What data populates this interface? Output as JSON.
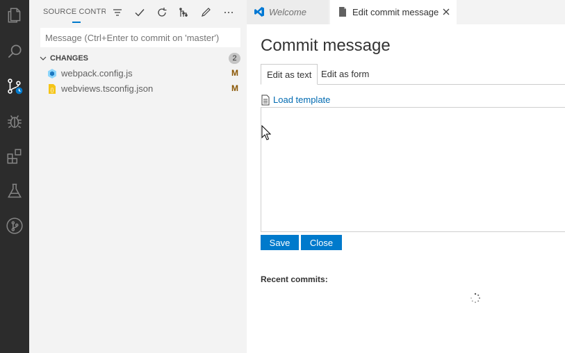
{
  "activity_bar": {
    "items": [
      {
        "icon": "explorer-icon"
      },
      {
        "icon": "search-icon"
      },
      {
        "icon": "source-control-icon",
        "active": true
      },
      {
        "icon": "debug-icon"
      },
      {
        "icon": "extensions-icon"
      },
      {
        "icon": "testing-icon"
      },
      {
        "icon": "git-graph-icon"
      }
    ]
  },
  "sidebar": {
    "title": "SOURCE CONTR...",
    "toolbar_icons": [
      "filter-icon",
      "commit-check-icon",
      "refresh-icon",
      "branch-graph-icon",
      "edit-pencil-icon",
      "more-actions-icon"
    ],
    "commit_placeholder": "Message (Ctrl+Enter to commit on 'master')",
    "changes": {
      "label": "CHANGES",
      "count": "2",
      "files": [
        {
          "name": "webpack.config.js",
          "status": "M",
          "icon": "webpack-file-icon"
        },
        {
          "name": "webviews.tsconfig.json",
          "status": "M",
          "icon": "json-file-icon"
        }
      ]
    }
  },
  "tabs": [
    {
      "label": "Welcome",
      "icon": "vscode-logo-icon",
      "active": false
    },
    {
      "label": "Edit commit message",
      "icon": "file-icon",
      "active": true
    }
  ],
  "editor": {
    "title": "Commit message",
    "mode_tabs": [
      "Edit as text",
      "Edit as form"
    ],
    "load_template": "Load template",
    "message": "",
    "buttons": {
      "save": "Save",
      "close": "Close"
    },
    "recent_commits_label": "Recent commits:"
  },
  "colors": {
    "activity_bar_bg": "#2c2c2c",
    "sidebar_bg": "#f3f3f3",
    "accent": "#007acc",
    "link": "#006ab1",
    "modified": "#895503"
  }
}
